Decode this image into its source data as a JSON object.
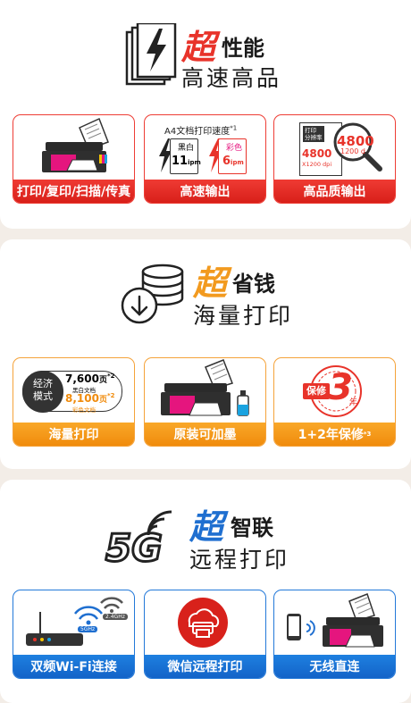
{
  "sections": [
    {
      "badge": "超",
      "keyword": "性能",
      "subtitle": "高速高品",
      "accent": "#e8332a",
      "cards": [
        {
          "label": "打印/复印/扫描/传真",
          "icon": "printer-icon"
        },
        {
          "label": "高速输出",
          "icon": "speed-doc-icon",
          "art": {
            "title": "A4文档打印速度",
            "title_sup": "*1",
            "mono_label": "黑白",
            "mono_value": "11",
            "mono_unit": "ipm",
            "color_label": "彩色",
            "color_value": "6",
            "color_unit": "ipm"
          }
        },
        {
          "label": "高品质输出",
          "icon": "resolution-icon",
          "art": {
            "doc_label_1": "打印",
            "doc_label_2": "分辨率",
            "res_value": "4800",
            "res_sub": "X1200 dpi",
            "zoom_value": "4800",
            "zoom_sub": "1200 d"
          }
        }
      ]
    },
    {
      "badge": "超",
      "keyword": "省钱",
      "subtitle": "海量打印",
      "accent": "#f29a1f",
      "cards": [
        {
          "label": "海量打印",
          "icon": "economy-mode-icon",
          "art": {
            "mode_1": "经济",
            "mode_2": "模式",
            "mono_pages": "7,600",
            "mono_unit": "页",
            "mono_sup": "*2",
            "mono_desc": "黑白文档",
            "color_pages": "8,100",
            "color_unit": "页",
            "color_sup": "*2",
            "color_desc": "彩色文档"
          }
        },
        {
          "label": "原装可加墨",
          "icon": "ink-refill-icon"
        },
        {
          "label": "1+2年保修",
          "label_sup": "*3",
          "icon": "warranty-icon",
          "art": {
            "stamp_text": "保修",
            "stamp_number": "3",
            "stamp_unit": "年"
          }
        }
      ]
    },
    {
      "badge": "超",
      "keyword": "智联",
      "subtitle": "远程打印",
      "prefix": "5G",
      "accent": "#1f6fd0",
      "cards": [
        {
          "label": "双频Wi-Fi连接",
          "icon": "router-icon",
          "art": {
            "band_1": "5GHz",
            "band_2": "2.4GHz"
          }
        },
        {
          "label": "微信远程打印",
          "icon": "cloud-print-icon"
        },
        {
          "label": "无线直连",
          "icon": "wireless-direct-icon"
        }
      ]
    }
  ]
}
